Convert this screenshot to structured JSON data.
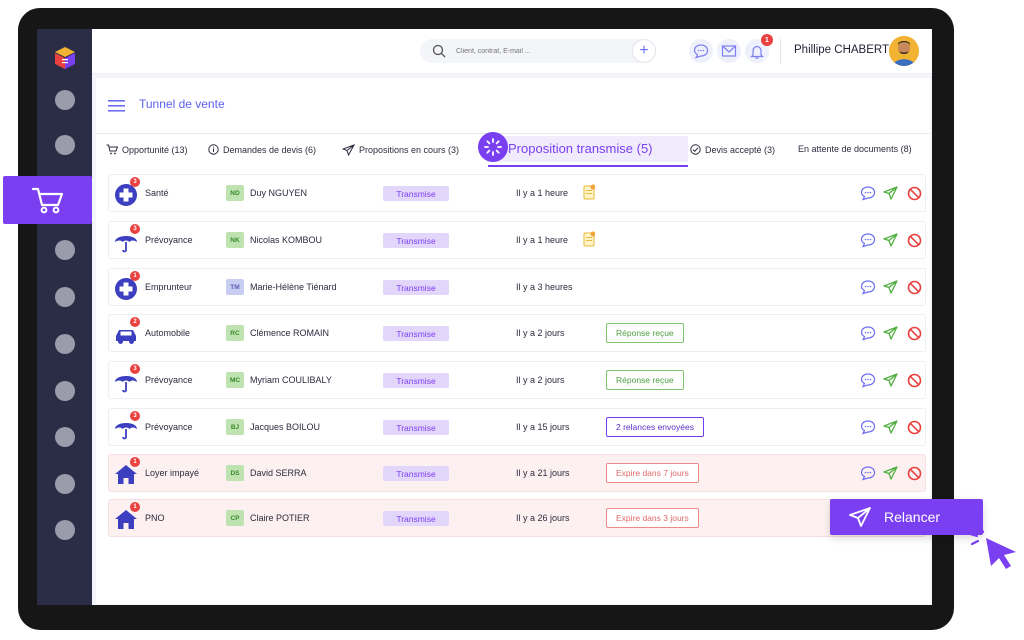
{
  "header": {
    "search_placeholder": "Client, contrat, E-mail ...",
    "notifications_count": "1",
    "user_name": "Phillipe CHABERT"
  },
  "page": {
    "title": "Tunnel de vente"
  },
  "tabs": [
    {
      "label": "Opportunité (13)"
    },
    {
      "label": "Demandes de devis (6)"
    },
    {
      "label": "Propositions en cours (3)"
    },
    {
      "label": "Proposition transmise (5)",
      "active": true
    },
    {
      "label": "Devis accepté (3)"
    },
    {
      "label": "En attente de documents (8)"
    }
  ],
  "rows": [
    {
      "category": "Santé",
      "icon": "medical-cross-icon",
      "badge": "3",
      "initials": "ND",
      "name": "Duy NGUYEN",
      "status": "Transmise",
      "time": "Il y a 1 heure",
      "doc": true,
      "tag": "",
      "tag_type": ""
    },
    {
      "category": "Prévoyance",
      "icon": "umbrella-icon",
      "badge": "3",
      "initials": "NK",
      "name": "Nicolas KOMBOU",
      "status": "Transmise",
      "time": "Il y a 1 heure",
      "doc": true,
      "tag": "",
      "tag_type": ""
    },
    {
      "category": "Emprunteur",
      "icon": "medical-cross-icon",
      "badge": "1",
      "initials": "TM",
      "name": "Marie-Hélène Tiénard",
      "status": "Transmise",
      "time": "Il y a 3 heures",
      "doc": false,
      "tag": "",
      "tag_type": ""
    },
    {
      "category": "Automobile",
      "icon": "car-icon",
      "badge": "2",
      "initials": "RC",
      "name": "Clémence ROMAIN",
      "status": "Transmise",
      "time": "Il y a 2 jours",
      "doc": false,
      "tag": "Réponse reçue",
      "tag_type": "green"
    },
    {
      "category": "Prévoyance",
      "icon": "umbrella-icon",
      "badge": "3",
      "initials": "MC",
      "name": "Myriam COULIBALY",
      "status": "Transmise",
      "time": "Il y a 2 jours",
      "doc": false,
      "tag": "Réponse reçue",
      "tag_type": "green"
    },
    {
      "category": "Prévoyance",
      "icon": "umbrella-icon",
      "badge": "3",
      "initials": "BJ",
      "name": "Jacques BOILOU",
      "status": "Transmise",
      "time": "Il y a 15 jours",
      "doc": false,
      "tag": "2 relances envoyées",
      "tag_type": "purple"
    },
    {
      "category": "Loyer impayé",
      "icon": "house-icon",
      "badge": "1",
      "initials": "DS",
      "name": "David SERRA",
      "status": "Transmise",
      "time": "Il y a 21 jours",
      "doc": false,
      "tag": "Expire dans 7 jours",
      "tag_type": "red"
    },
    {
      "category": "PNO",
      "icon": "house-icon",
      "badge": "1",
      "initials": "CP",
      "name": "Claire POTIER",
      "status": "Transmise",
      "time": "Il y a 26 jours",
      "doc": false,
      "tag": "Expire dans 3 jours",
      "tag_type": "red"
    }
  ],
  "cta": {
    "label": "Relancer"
  },
  "colors": {
    "accent": "#7b3ff2",
    "sidebar": "#2b2d47",
    "link": "#5b5ff0",
    "alert_row": "#fdf0f1"
  }
}
